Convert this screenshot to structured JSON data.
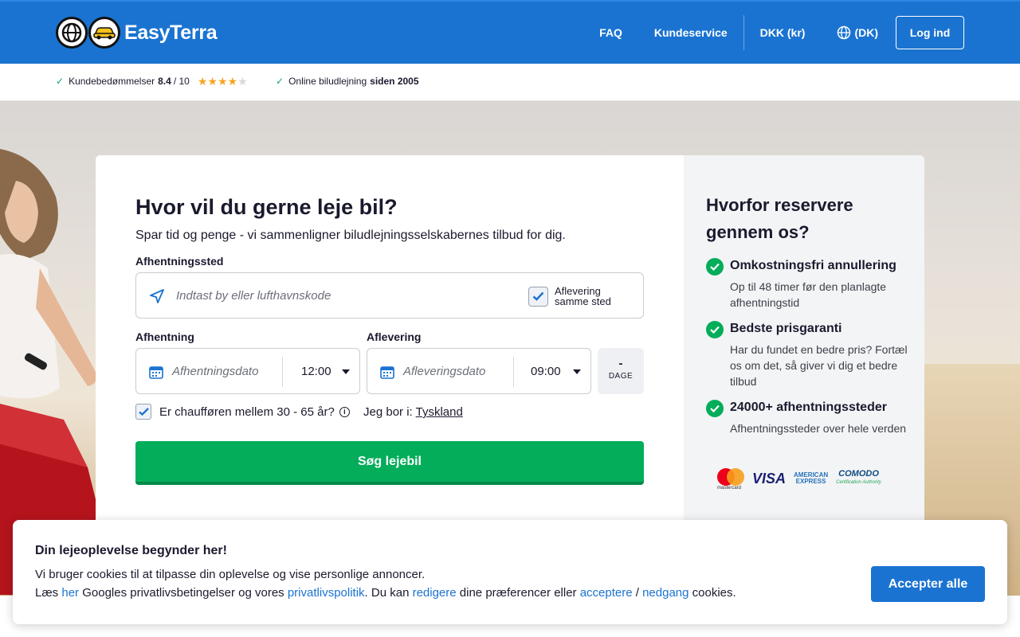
{
  "header": {
    "brand": "EasyTerra",
    "nav": {
      "faq": "FAQ",
      "service": "Kundeservice",
      "currency": "DKK (kr)",
      "lang": "(DK)",
      "login": "Log ind"
    }
  },
  "trust": {
    "ratings_label": "Kundebedømmelser",
    "score": "8.4",
    "score_max": "/ 10",
    "stars_filled": 4,
    "stars_total": 5,
    "online_prefix": "Online biludlejning",
    "online_since": "siden 2005"
  },
  "form": {
    "title": "Hvor vil du gerne leje bil?",
    "subtitle": "Spar tid og penge - vi sammenligner biludlejningsselskabernes tilbud for dig.",
    "pickup_place_label": "Afhentningssted",
    "pickup_place_placeholder": "Indtast by eller lufthavnskode",
    "same_place_line1": "Aflevering",
    "same_place_line2": "samme sted",
    "pickup_label": "Afhentning",
    "pickup_date_placeholder": "Afhentningsdato",
    "pickup_time": "12:00",
    "dropoff_label": "Aflevering",
    "dropoff_date_placeholder": "Afleveringsdato",
    "dropoff_time": "09:00",
    "days_value": "-",
    "days_label": "DAGE",
    "driver_question": "Er chaufføren mellem 30 - 65 år?",
    "live_prefix": "Jeg bor i:",
    "live_country": "Tyskland",
    "search_button": "Søg lejebil"
  },
  "why": {
    "title": "Hvorfor reservere gennem os?",
    "benefits": [
      {
        "title": "Omkostningsfri annullering",
        "desc": "Op til 48 timer før den planlagte afhentningstid"
      },
      {
        "title": "Bedste prisgaranti",
        "desc": "Har du fundet en bedre pris? Fortæl os om det, så giver vi dig et bedre tilbud"
      },
      {
        "title": "24000+ afhentningssteder",
        "desc": "Afhentningssteder over hele verden"
      }
    ],
    "payments": {
      "mastercard": "mastercard",
      "visa": "VISA",
      "amex_1": "AMERICAN",
      "amex_2": "EXPRESS",
      "comodo": "COMODO",
      "comodo_sub": "Certification Authority"
    }
  },
  "cookie": {
    "title": "Din lejeoplevelse begynder her!",
    "line1": "Vi bruger cookies til at tilpasse din oplevelse og vise personlige annoncer.",
    "l2_a": "Læs ",
    "l2_her": "her",
    "l2_b": " Googles privatlivsbetingelser og vores ",
    "l2_policy": "privatlivspolitik",
    "l2_c": ". Du kan ",
    "l2_edit": "redigere",
    "l2_d": " dine præferencer eller ",
    "l2_accept": "acceptere",
    "l2_e": " / ",
    "l2_decline": "nedgang",
    "l2_f": " cookies.",
    "accept_all": "Accepter alle"
  },
  "colors": {
    "brand_blue": "#1a73d1",
    "cta_green": "#03ad5a",
    "star": "#f5a623"
  }
}
